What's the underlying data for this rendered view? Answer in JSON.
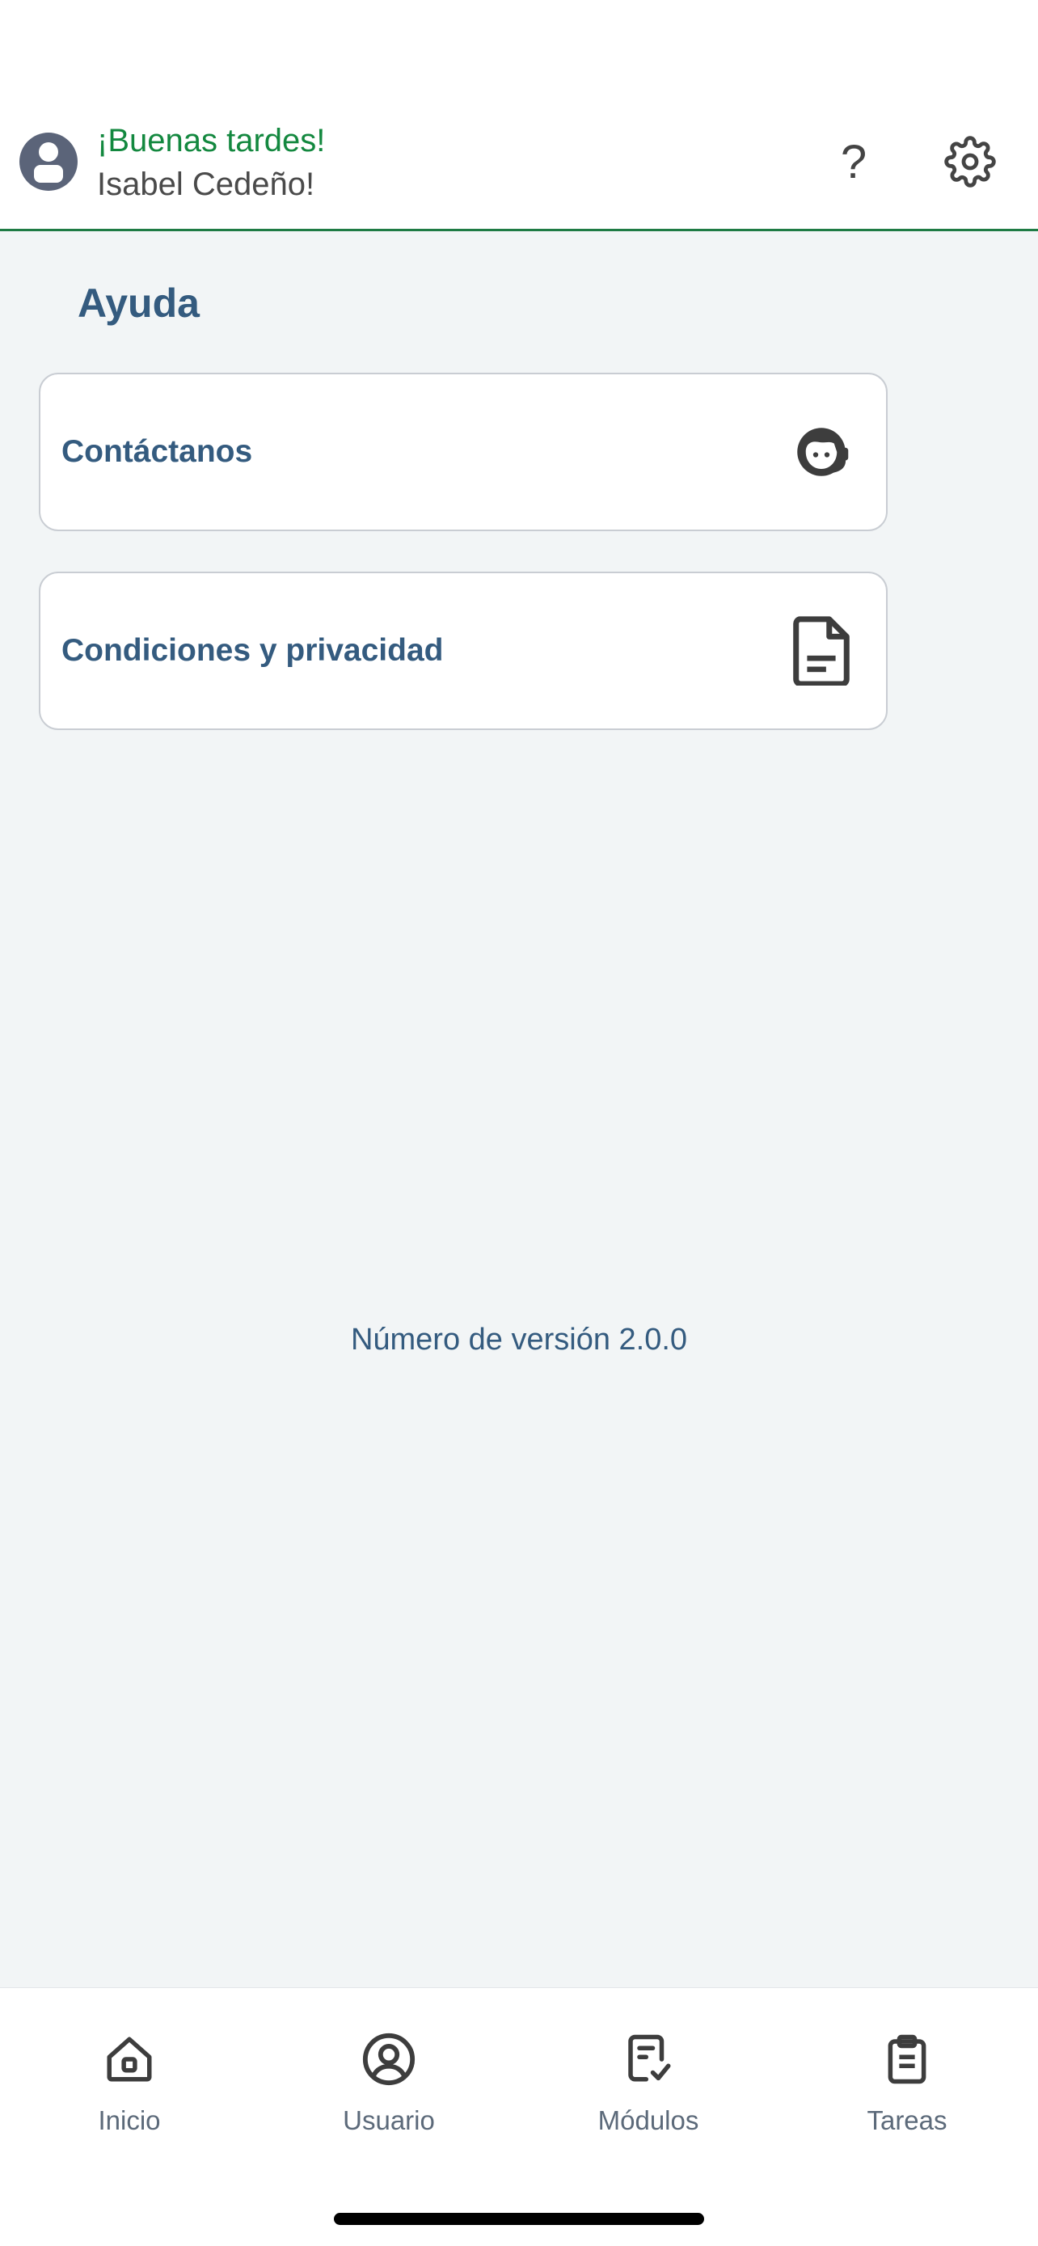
{
  "header": {
    "greeting": "¡Buenas tardes!",
    "user_name": "Isabel Cedeño!",
    "help_label": "?",
    "avatar_icon": "user-avatar-icon",
    "settings_icon": "gear-icon"
  },
  "main": {
    "title": "Ayuda",
    "cards": [
      {
        "label": "Contáctanos",
        "icon": "support-agent-icon"
      },
      {
        "label": "Condiciones y privacidad",
        "icon": "document-icon"
      }
    ],
    "version_text": "Número de versión 2.0.0"
  },
  "bottom_nav": {
    "items": [
      {
        "label": "Inicio",
        "icon": "home-icon"
      },
      {
        "label": "Usuario",
        "icon": "user-circle-icon"
      },
      {
        "label": "Módulos",
        "icon": "checklist-icon"
      },
      {
        "label": "Tareas",
        "icon": "clipboard-icon"
      }
    ]
  },
  "colors": {
    "accent_green": "#13883f",
    "primary_blue": "#345b7f",
    "background": "#f2f5f6"
  }
}
